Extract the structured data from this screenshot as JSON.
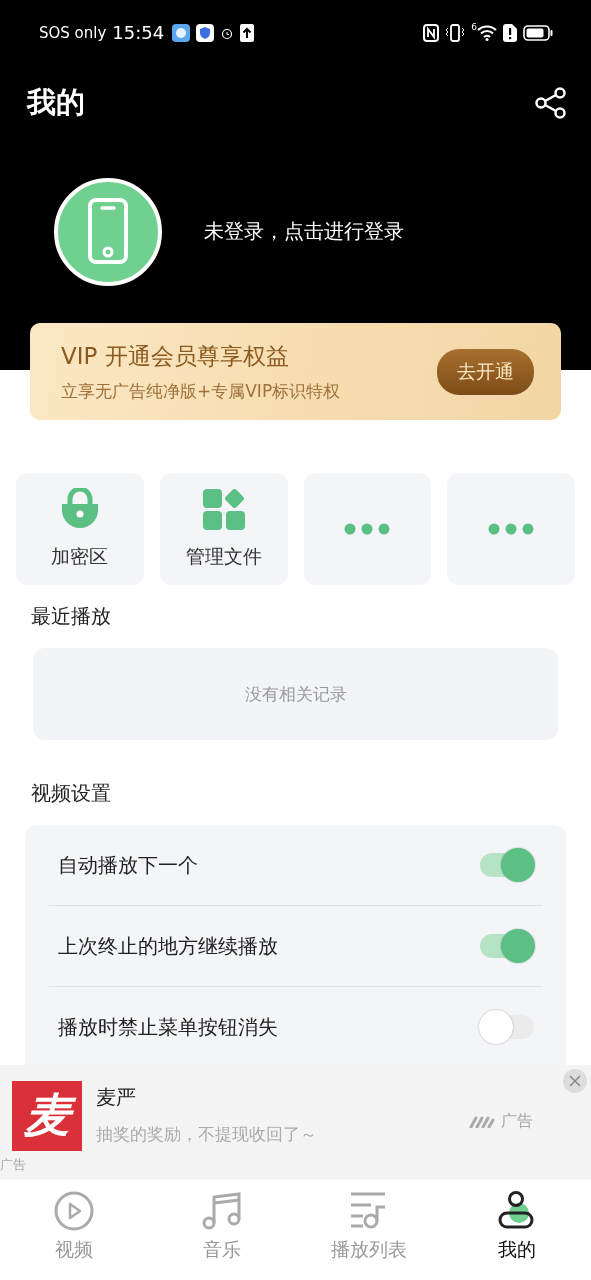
{
  "status_bar": {
    "carrier": "SOS only",
    "time": "15:54",
    "signal_label": "6"
  },
  "header": {
    "title": "我的"
  },
  "profile": {
    "login_text": "未登录，点击进行登录"
  },
  "vip_banner": {
    "title": "VIP  开通会员尊享权益",
    "subtitle": "立享无广告纯净版+专属VIP标识特权",
    "button": "去开通"
  },
  "shortcuts": [
    {
      "kind": "lock",
      "label": "加密区"
    },
    {
      "kind": "grid",
      "label": "管理文件"
    },
    {
      "kind": "dots"
    },
    {
      "kind": "dots"
    }
  ],
  "recent": {
    "title": "最近播放",
    "empty_text": "没有相关记录"
  },
  "video_settings": {
    "title": "视频设置",
    "items": [
      {
        "label": "自动播放下一个",
        "on": true
      },
      {
        "label": "上次终止的地方继续播放",
        "on": true
      },
      {
        "label": "播放时禁止菜单按钮消失",
        "on": false
      }
    ]
  },
  "ad": {
    "logo": "麦",
    "title": "麦严",
    "description": "抽奖的奖励，不提现收回了～",
    "tag": "广告",
    "corner_tag": "广告"
  },
  "bottom_nav": [
    {
      "kind": "video",
      "label": "视频",
      "selected": false
    },
    {
      "kind": "music",
      "label": "音乐",
      "selected": false
    },
    {
      "kind": "playlist",
      "label": "播放列表",
      "selected": false
    },
    {
      "kind": "me",
      "label": "我的",
      "selected": true
    }
  ]
}
